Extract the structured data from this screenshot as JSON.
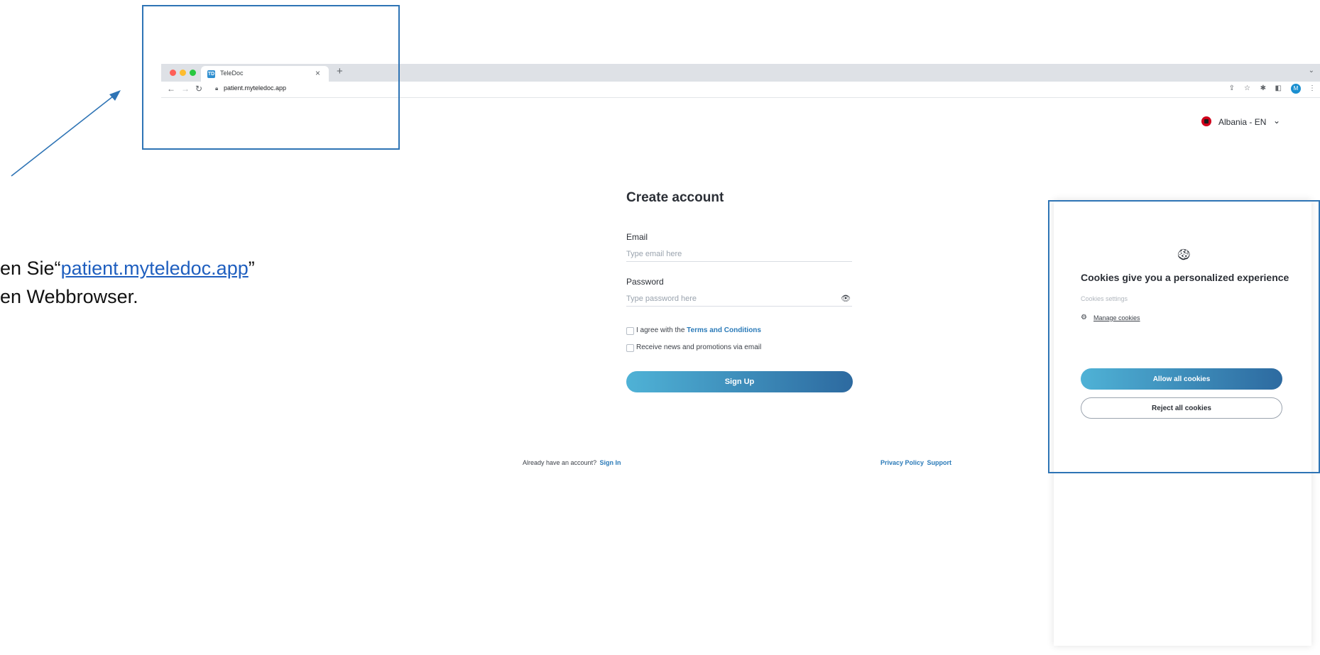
{
  "browser": {
    "tab_title": "TeleDoc",
    "tab_favicon": "TD",
    "close_glyph": "×",
    "new_tab_glyph": "+",
    "url": "patient.myteledoc.app",
    "avatar_letter": "M"
  },
  "instruction": {
    "line1_prefix": "en Sie“",
    "link_text": "patient.myteledoc.app",
    "line1_suffix": "”",
    "line2": "en Webbrowser."
  },
  "language": {
    "selected": "Albania - EN"
  },
  "form": {
    "title": "Create account",
    "email_label": "Email",
    "email_placeholder": "Type email here",
    "password_label": "Password",
    "password_placeholder": "Type password here",
    "agree_prefix": "I agree with the",
    "terms_link": "Terms and Conditions",
    "news_label": "Receive news and promotions via email",
    "signup_button": "Sign Up"
  },
  "footer": {
    "have_account": "Already have an account?",
    "sign_in": "Sign In",
    "privacy": "Privacy Policy",
    "support": "Support"
  },
  "cookies": {
    "title": "Cookies give you a personalized experience",
    "settings_label": "Cookies settings",
    "manage_link": "Manage cookies",
    "allow_button": "Allow all cookies",
    "reject_button": "Reject all cookies"
  },
  "colors": {
    "accent_start": "#4fb2d6",
    "accent_end": "#2d6aa0",
    "annotation_border": "#2e74b5",
    "link": "#2a7ab8"
  }
}
